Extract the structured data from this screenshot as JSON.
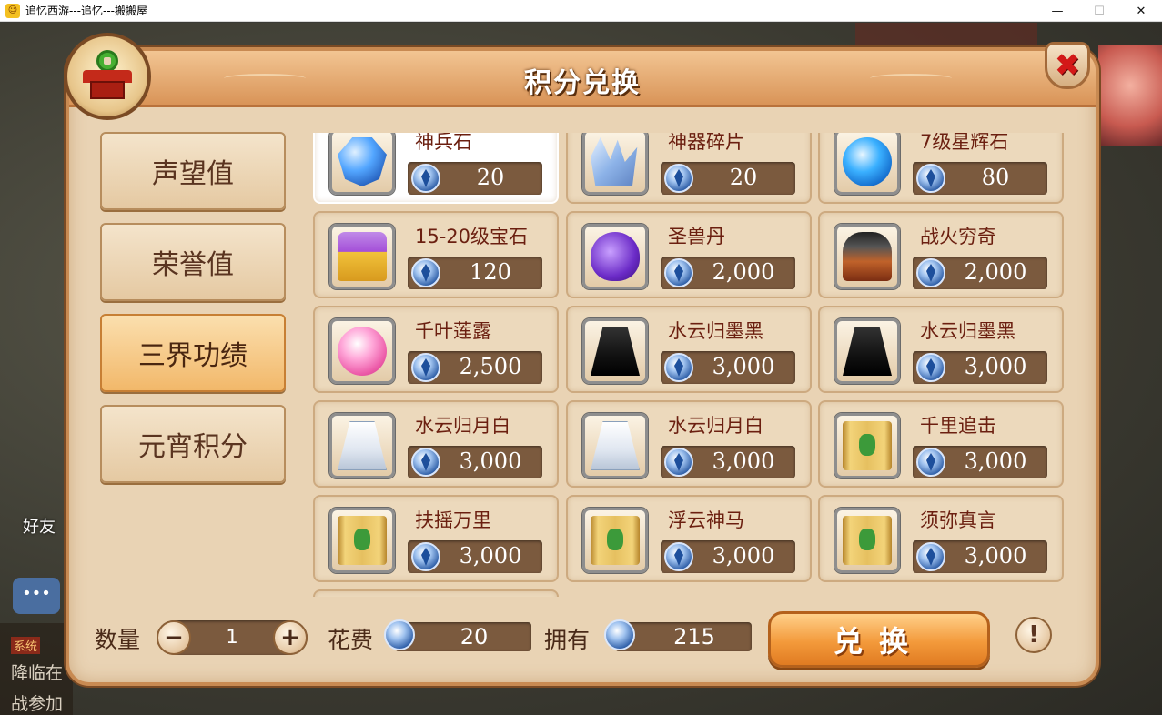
{
  "window": {
    "title": "追忆西游---追忆---搬搬屋",
    "minimize": "—",
    "maximize": "☐",
    "close": "✕"
  },
  "background": {
    "friend_label": "好友",
    "chat_system": "系统",
    "chat_line1": "降临在",
    "chat_line2": "战参加"
  },
  "panel": {
    "title": "积分兑换",
    "close_glyph": "✖"
  },
  "tabs": [
    {
      "label": "声望值",
      "active": false
    },
    {
      "label": "荣誉值",
      "active": false
    },
    {
      "label": "三界功绩",
      "active": true
    },
    {
      "label": "元宵积分",
      "active": false
    }
  ],
  "items": [
    {
      "name": "神兵石",
      "price": "20",
      "icon": "blue-gem-icon",
      "selected": true
    },
    {
      "name": "神器碎片",
      "price": "20",
      "icon": "crystal-shard-icon"
    },
    {
      "name": "7级星辉石",
      "price": "80",
      "icon": "blue-orb-icon"
    },
    {
      "name": "15-20级宝石",
      "price": "120",
      "icon": "treasure-chest-icon"
    },
    {
      "name": "圣兽丹",
      "price": "2,000",
      "icon": "purple-gourd-icon"
    },
    {
      "name": "战火穷奇",
      "price": "2,000",
      "icon": "war-beast-icon"
    },
    {
      "name": "千叶莲露",
      "price": "2,500",
      "icon": "candy-orb-icon"
    },
    {
      "name": "水云归墨黑",
      "price": "3,000",
      "icon": "black-robe-icon"
    },
    {
      "name": "水云归墨黑",
      "price": "3,000",
      "icon": "black-robe-icon"
    },
    {
      "name": "水云归月白",
      "price": "3,000",
      "icon": "white-robe-icon"
    },
    {
      "name": "水云归月白",
      "price": "3,000",
      "icon": "white-robe-icon"
    },
    {
      "name": "千里追击",
      "price": "3,000",
      "icon": "skill-scroll-icon"
    },
    {
      "name": "扶摇万里",
      "price": "3,000",
      "icon": "skill-scroll-icon"
    },
    {
      "name": "浮云神马",
      "price": "3,000",
      "icon": "skill-scroll-icon"
    },
    {
      "name": "须弥真言",
      "price": "3,000",
      "icon": "skill-scroll-icon"
    }
  ],
  "bottom": {
    "quantity_label": "数量",
    "quantity": "1",
    "minus": "−",
    "plus": "+",
    "cost_label": "花费",
    "cost": "20",
    "own_label": "拥有",
    "owned": "215",
    "exchange_label": "兑换",
    "help": "!"
  }
}
